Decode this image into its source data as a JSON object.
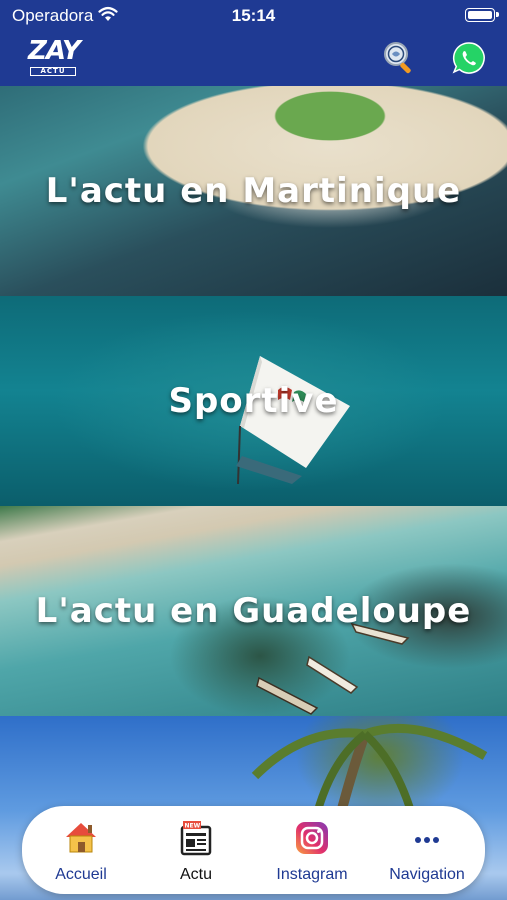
{
  "status_bar": {
    "carrier": "Operadora",
    "time": "15:14"
  },
  "header": {
    "logo_main": "ZAY",
    "logo_sub": "ACTU",
    "icons": [
      "search-icon",
      "whatsapp-icon"
    ]
  },
  "tiles": [
    {
      "title": "L'actu en Martinique"
    },
    {
      "title": "Sportive"
    },
    {
      "title": "L'actu en Guadeloupe"
    },
    {
      "title": ""
    }
  ],
  "bottom_nav": {
    "items": [
      {
        "label": "Accueil",
        "icon": "home-icon"
      },
      {
        "label": "Actu",
        "icon": "newspaper-icon"
      },
      {
        "label": "Instagram",
        "icon": "instagram-icon"
      },
      {
        "label": "Navigation",
        "icon": "more-dots-icon"
      }
    ]
  },
  "colors": {
    "brand": "#1f3a93",
    "nav_label": "#1f3a93",
    "instagram": "#e1306c",
    "whatsapp": "#25d366"
  }
}
